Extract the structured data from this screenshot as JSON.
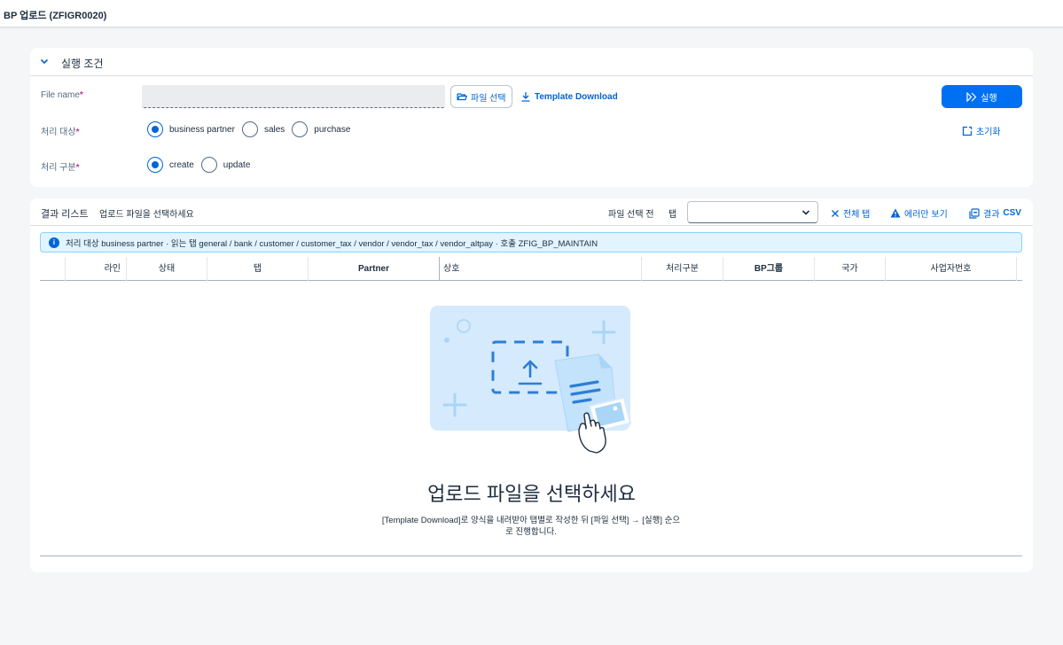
{
  "app": {
    "title": "BP 업로드 (ZFIGR0020)"
  },
  "conditions": {
    "section_title": "실행 조건",
    "file_name_label": "File name",
    "file_name_value": "",
    "file_select_label": "파일 선택",
    "template_download_label": "Template Download",
    "run_label": "실행",
    "reset_label": "초기화",
    "target_label": "처리 대상",
    "target_options": [
      "business partner",
      "sales",
      "purchase"
    ],
    "target_selected": "business partner",
    "mode_label": "처리 구분",
    "mode_options": [
      "create",
      "update"
    ],
    "mode_selected": "create",
    "required_mark": "*"
  },
  "results": {
    "title": "결과 리스트",
    "subtitle": "업로드 파일을 선택하세요",
    "status_text": "파일 선택 전",
    "tab_label": "탭",
    "tab_select_value": "",
    "all_tabs_label": "전체 탭",
    "errors_only_label": "에러만 보기",
    "csv_prefix": "결과",
    "csv_label": "CSV",
    "info_text": "처리 대상 business partner · 읽는 탭 general / bank / customer / customer_tax / vendor / vendor_tax / vendor_altpay · 호출 ZFIG_BP_MAINTAIN",
    "columns": [
      "라인",
      "상태",
      "탭",
      "Partner",
      "상호",
      "처리구분",
      "BP그룹",
      "국가",
      "사업자번호"
    ],
    "rows": [],
    "empty_title": "업로드 파일을 선택하세요",
    "empty_desc": "[Template Download]로 양식을 내려받아 탭별로 작성한 뒤 [파일 선택] → [실행] 순으로 진행합니다."
  },
  "colors": {
    "accent": "#0070f2",
    "link": "#0064d9",
    "required": "#c0399f",
    "info_bg": "#e1f4ff"
  }
}
